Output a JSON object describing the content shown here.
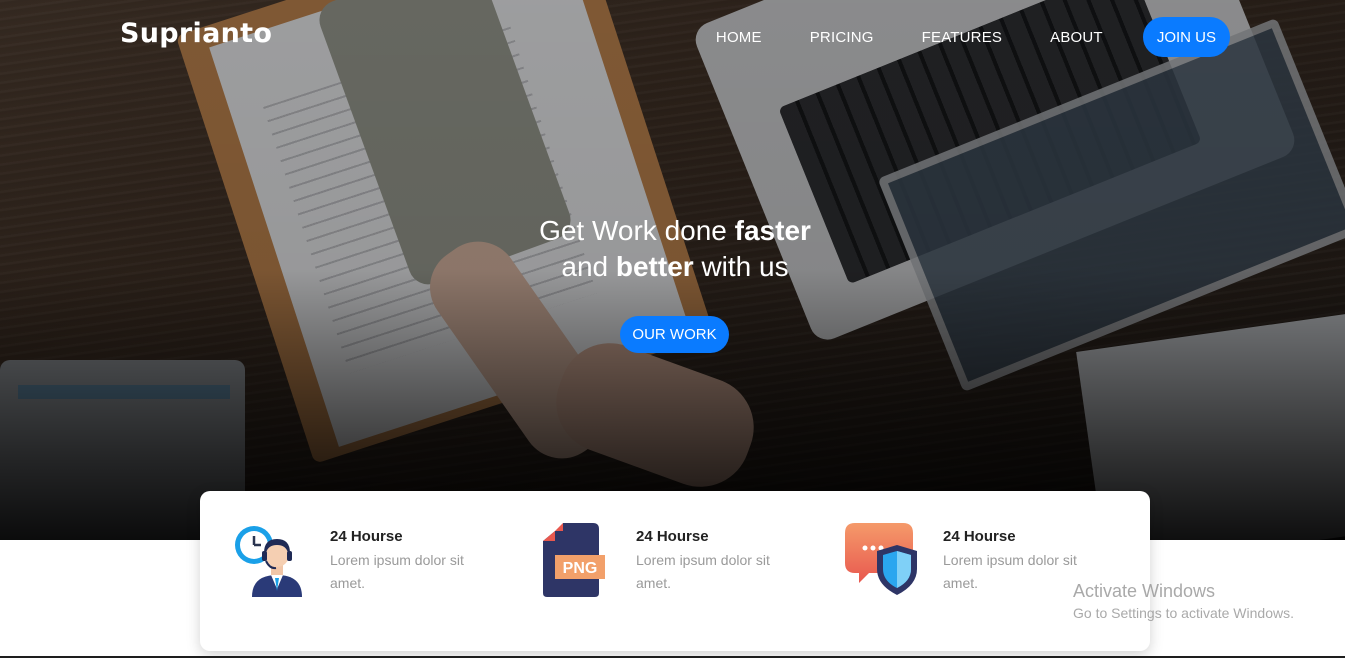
{
  "brand": "Suprianto",
  "nav": {
    "links": [
      "HOME",
      "PRICING",
      "FEATURES",
      "ABOUT"
    ],
    "join_label": "JOIN US"
  },
  "hero": {
    "line1_normal": "Get Work done ",
    "line1_bold": "faster",
    "line2_normal_a": "and ",
    "line2_bold": "better",
    "line2_normal_b": " with us",
    "cta_label": "OUR WORK"
  },
  "features": [
    {
      "icon": "support-agent-icon",
      "title": "24 Hourse",
      "text": "Lorem ipsum dolor sit amet."
    },
    {
      "icon": "png-file-icon",
      "title": "24 Hourse",
      "text": "Lorem ipsum dolor sit amet.",
      "badge": "PNG"
    },
    {
      "icon": "security-chat-icon",
      "title": "24 Hourse",
      "text": "Lorem ipsum dolor sit amet."
    }
  ],
  "watermark": {
    "title": "Activate Windows",
    "subtitle": "Go to Settings to activate Windows."
  },
  "colors": {
    "accent": "#0a7bff",
    "title_text": "#222222",
    "muted_text": "#9a9a9a"
  }
}
